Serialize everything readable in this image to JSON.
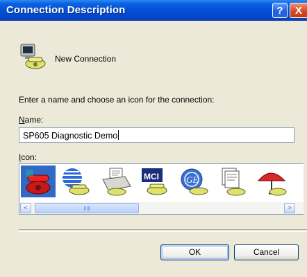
{
  "window": {
    "title": "Connection Description",
    "help_glyph": "?",
    "close_glyph": "X"
  },
  "header": {
    "icon": "new-connection-phone-icon",
    "label": "New Connection"
  },
  "instructions": "Enter a name and choose an icon for the connection:",
  "name_field": {
    "label_accel": "N",
    "label_rest": "ame:",
    "value": "SP605 Diagnostic Demo"
  },
  "icon_field": {
    "label_accel": "I",
    "label_rest": "con:",
    "selected_index": 0,
    "icons": [
      "red-phone-icon",
      "globe-phone-icon",
      "fax-machine-icon",
      "mci-phone-icon",
      "ge-logo-phone-icon",
      "documents-phone-icon",
      "umbrella-phone-icon"
    ]
  },
  "scrollbar": {
    "left_arrow": "<",
    "right_arrow": ">"
  },
  "buttons": {
    "ok": "OK",
    "cancel": "Cancel"
  },
  "colors": {
    "titlebar": "#0250d6",
    "dialog_bg": "#ece9d8",
    "selection": "#316ac5"
  }
}
